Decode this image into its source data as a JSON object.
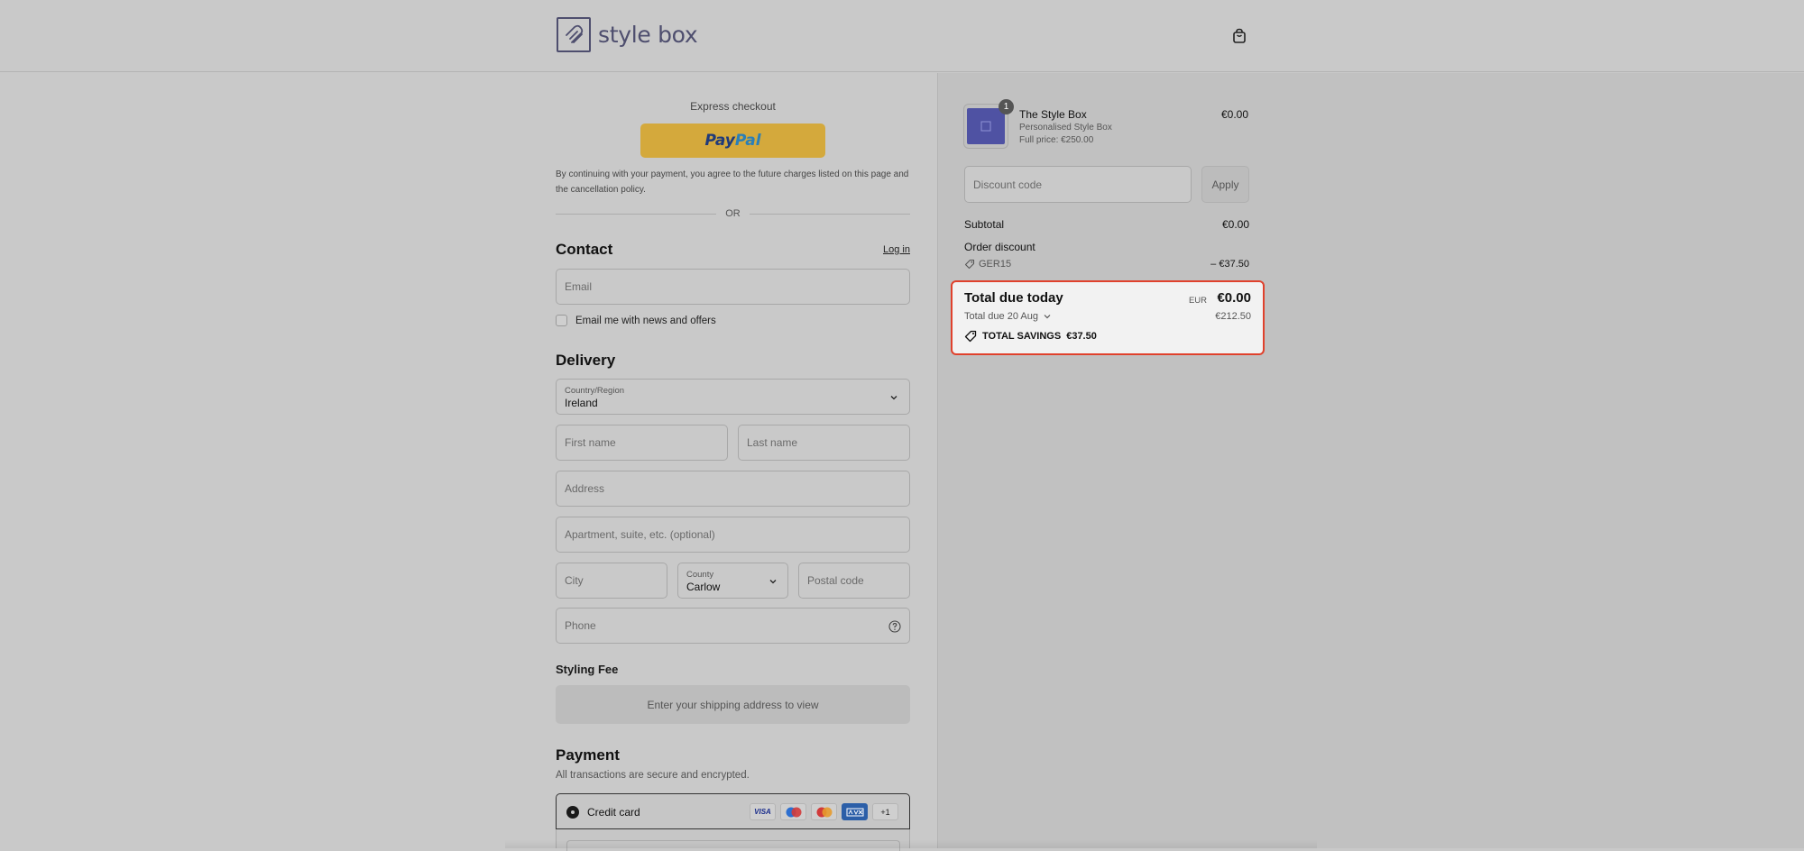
{
  "header": {
    "logo_text": "style box",
    "cart_icon": "shopping-bag-icon"
  },
  "express": {
    "title": "Express checkout",
    "paypal_part1": "Pay",
    "paypal_part2": "Pal",
    "legal": "By continuing with your payment, you agree to the future charges listed on this page and the cancellation policy.",
    "or_text": "OR"
  },
  "contact": {
    "title": "Contact",
    "login": "Log in",
    "email_placeholder": "Email",
    "news_label": "Email me with news and offers"
  },
  "delivery": {
    "title": "Delivery",
    "country_label": "Country/Region",
    "country_value": "Ireland",
    "first_name_placeholder": "First name",
    "last_name_placeholder": "Last name",
    "address_placeholder": "Address",
    "apartment_placeholder": "Apartment, suite, etc. (optional)",
    "city_placeholder": "City",
    "county_label": "County",
    "county_value": "Carlow",
    "postal_placeholder": "Postal code",
    "phone_placeholder": "Phone"
  },
  "styling_fee": {
    "title": "Styling Fee",
    "message": "Enter your shipping address to view"
  },
  "payment": {
    "title": "Payment",
    "subtitle": "All transactions are secure and encrypted.",
    "method_label": "Credit card",
    "cards": [
      "VISA",
      "Maestro",
      "Mastercard",
      "AMEX"
    ],
    "more_cards": "+1"
  },
  "summary": {
    "quantity": "1",
    "product_name": "The Style Box",
    "product_sub": "Personalised Style Box",
    "product_full_price": "Full price: €250.00",
    "product_price": "€0.00",
    "discount_placeholder": "Discount code",
    "apply_label": "Apply",
    "subtotal_label": "Subtotal",
    "subtotal_value": "€0.00",
    "order_discount_label": "Order discount",
    "discount_code": "GER15",
    "discount_value": "– €37.50",
    "total_label": "Total due today",
    "currency": "EUR",
    "total_value": "€0.00",
    "due_later_label": "Total due 20 Aug",
    "due_later_value": "€212.50",
    "savings_label": "TOTAL SAVINGS",
    "savings_value": "€37.50"
  },
  "colors": {
    "highlight_border": "#e0412c",
    "paypal_button": "#d4a93c",
    "brand": "#4e4e6e"
  }
}
